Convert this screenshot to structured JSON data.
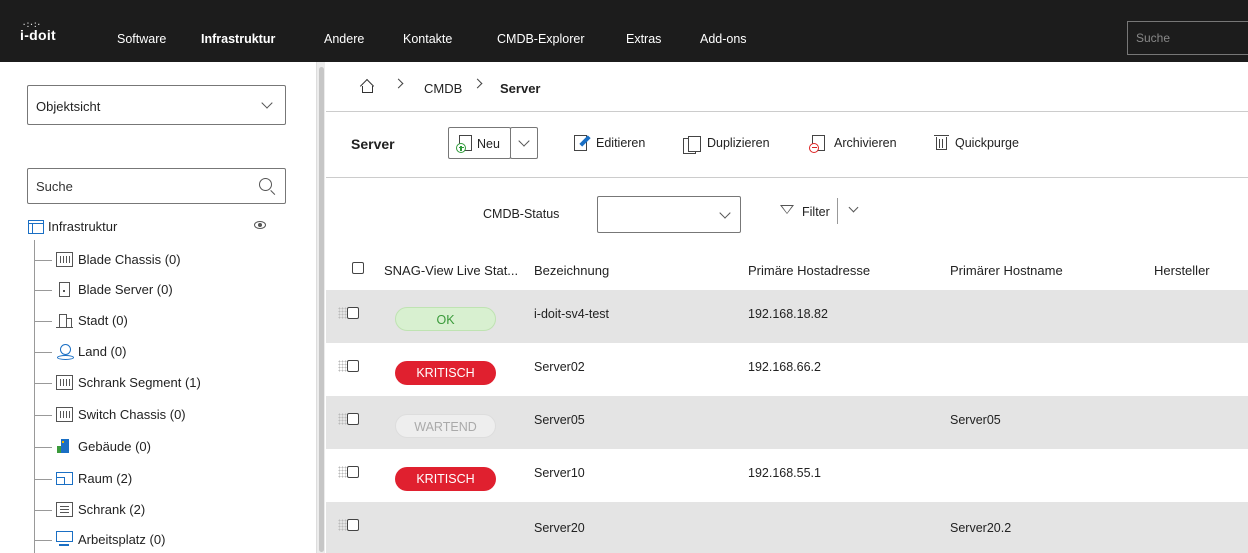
{
  "topnav": {
    "logo": "i-doit",
    "items": [
      {
        "label": "Software"
      },
      {
        "label": "Infrastruktur"
      },
      {
        "label": "Andere"
      },
      {
        "label": "Kontakte"
      },
      {
        "label": "CMDB-Explorer"
      },
      {
        "label": "Extras"
      },
      {
        "label": "Add-ons"
      }
    ],
    "active": "Infrastruktur",
    "search_placeholder": "Suche"
  },
  "sidebar": {
    "view_select": "Objektsicht",
    "search_placeholder": "Suche",
    "root": "Infrastruktur",
    "items": [
      {
        "label": "Blade Chassis (0)",
        "icon": "rack-icon"
      },
      {
        "label": "Blade Server (0)",
        "icon": "server-icon"
      },
      {
        "label": "Stadt (0)",
        "icon": "city-icon"
      },
      {
        "label": "Land (0)",
        "icon": "location-pin-icon"
      },
      {
        "label": "Schrank Segment (1)",
        "icon": "rack-icon"
      },
      {
        "label": "Switch Chassis (0)",
        "icon": "rack-icon"
      },
      {
        "label": "Gebäude (0)",
        "icon": "building-icon"
      },
      {
        "label": "Raum (2)",
        "icon": "room-icon"
      },
      {
        "label": "Schrank (2)",
        "icon": "cabinet-icon"
      },
      {
        "label": "Arbeitsplatz (0)",
        "icon": "workstation-icon"
      }
    ]
  },
  "breadcrumb": {
    "items": [
      "CMDB",
      "Server"
    ]
  },
  "toolbar": {
    "title": "Server",
    "new_label": "Neu",
    "edit_label": "Editieren",
    "duplicate_label": "Duplizieren",
    "archive_label": "Archivieren",
    "quickpurge_label": "Quickpurge"
  },
  "filter": {
    "status_label": "CMDB-Status",
    "status_value": "",
    "filter_label": "Filter"
  },
  "table": {
    "columns": [
      "SNAG-View Live Stat...",
      "Bezeichnung",
      "Primäre Hostadresse",
      "Primärer Hostname",
      "Hersteller"
    ],
    "rows": [
      {
        "status": "OK",
        "status_kind": "ok",
        "name": "i-doit-sv4-test",
        "host_address": "192.168.18.82",
        "hostname": "",
        "vendor": ""
      },
      {
        "status": "KRITISCH",
        "status_kind": "critical",
        "name": "Server02",
        "host_address": "192.168.66.2",
        "hostname": "",
        "vendor": ""
      },
      {
        "status": "WARTEND",
        "status_kind": "pending",
        "name": "Server05",
        "host_address": "",
        "hostname": "Server05",
        "vendor": ""
      },
      {
        "status": "KRITISCH",
        "status_kind": "critical",
        "name": "Server10",
        "host_address": "192.168.55.1",
        "hostname": "",
        "vendor": ""
      },
      {
        "status": "",
        "status_kind": "none",
        "name": "Server20",
        "host_address": "",
        "hostname": "Server20.2",
        "vendor": ""
      }
    ]
  },
  "colors": {
    "topbar_bg": "#1c1c1c",
    "critical": "#e0202f",
    "ok_bg": "#d8f0d0",
    "ok_text": "#3a9a3a",
    "row_alt": "#e4e4e4",
    "link_blue": "#1a6fc4"
  }
}
